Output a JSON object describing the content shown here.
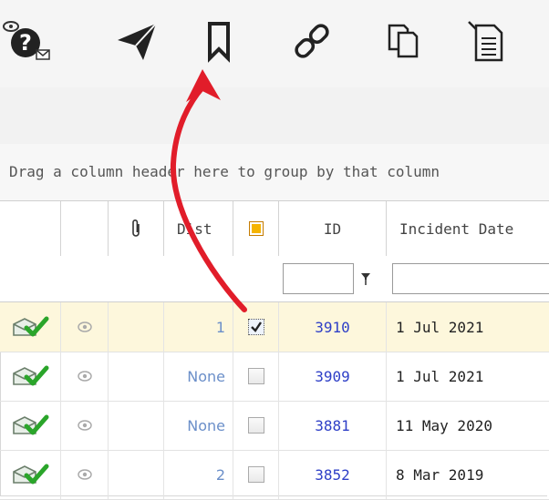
{
  "toolbar": {
    "icons": [
      "help-icon",
      "send-icon",
      "bookmark-icon",
      "link-icon",
      "copy-icon",
      "document-edit-icon"
    ]
  },
  "grid": {
    "group_hint": "Drag a column header here to group by that column",
    "headers": {
      "dist": "Dist",
      "id": "ID",
      "incident_date": "Incident Date"
    },
    "rows": [
      {
        "dist": "1",
        "checked": true,
        "id": "3910",
        "incident_date": "1 Jul 2021"
      },
      {
        "dist": "None",
        "checked": false,
        "id": "3909",
        "incident_date": "1 Jul 2021"
      },
      {
        "dist": "None",
        "checked": false,
        "id": "3881",
        "incident_date": "11 May 2020"
      },
      {
        "dist": "2",
        "checked": false,
        "id": "3852",
        "incident_date": "8 Mar 2019"
      }
    ]
  },
  "colors": {
    "annotation_arrow": "#e11d2a",
    "selected_row": "#fdf7dc",
    "id_link": "#2e3fc7",
    "check_green": "#2aa52a"
  }
}
